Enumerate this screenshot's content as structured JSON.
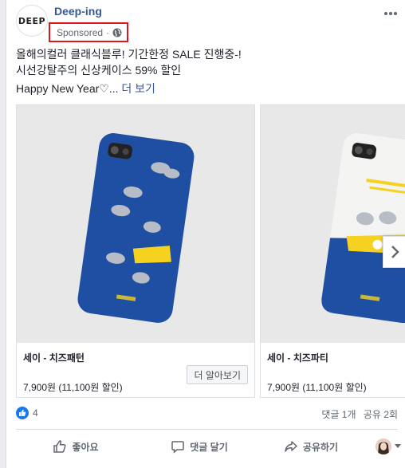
{
  "post": {
    "page_name": "Deep-ing",
    "avatar_text": "DEEP",
    "sponsored": "Sponsored",
    "separator": "·",
    "text_lines": [
      "올해의컬러 클래식블루! 기간한정 SALE 진행중-!",
      "시선강탈주의 신상케이스 59% 할인"
    ],
    "happy_text": "Happy New Year♡...",
    "see_more": "더 보기"
  },
  "carousel": {
    "cards": [
      {
        "title": "세이 - 치즈패턴",
        "price": "7,900원 (11,100원 할인)",
        "cta": "더 알아보기"
      },
      {
        "title": "세이 - 치즈파티",
        "price": "7,900원 (11,100원 할인)"
      }
    ]
  },
  "stats": {
    "likes": "4",
    "comments": "댓글 1개",
    "shares": "공유 2회"
  },
  "actions": {
    "like": "좋아요",
    "comment": "댓글 달기",
    "share": "공유하기"
  },
  "colors": {
    "accent": "#385898",
    "sponsored_highlight": "#e0161e",
    "case_blue": "#1f4fa3",
    "cheese_yellow": "#f5d21f"
  }
}
